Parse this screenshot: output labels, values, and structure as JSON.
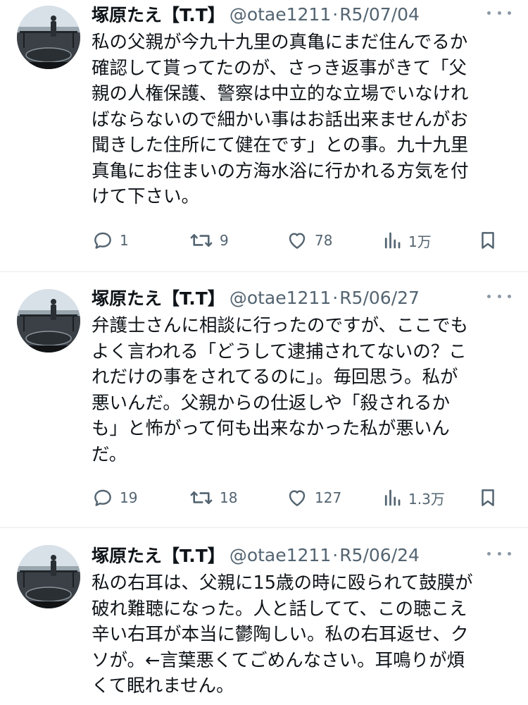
{
  "tweets": [
    {
      "name": "塚原たえ【T.T】",
      "handle": "@otae1211",
      "separator": "·",
      "date": "R5/07/04",
      "lines": [
        "私の父親が今九十九里の真亀にまだ住んでるか",
        "確認して貰ってたのが、さっき返事がきて「父",
        "親の人権保護、警察は中立的な立場でいなけれ",
        "ばならないので細かい事はお話出来ませんがお",
        "聞きした住所にて健在です」との事。九十九里",
        "真亀にお住まいの方海水浴に行かれる方気を付",
        "けて下さい。"
      ],
      "replies": "1",
      "retweets": "9",
      "likes": "78",
      "views": "1万"
    },
    {
      "name": "塚原たえ【T.T】",
      "handle": "@otae1211",
      "separator": "·",
      "date": "R5/06/27",
      "lines": [
        "弁護士さんに相談に行ったのですが、ここでも",
        "よく言われる「どうして逮捕されてないの？こ",
        "れだけの事をされてるのに」。毎回思う。私が",
        "悪いんだ。父親からの仕返しや「殺されるか",
        "も」と怖がって何も出来なかった私が悪いん",
        "だ。"
      ],
      "replies": "19",
      "retweets": "18",
      "likes": "127",
      "views": "1.3万"
    },
    {
      "name": "塚原たえ【T.T】",
      "handle": "@otae1211",
      "separator": "·",
      "date": "R5/06/24",
      "lines": [
        "私の右耳は、父親に15歳の時に殴られて鼓膜が",
        "破れ難聴になった。人と話してて、この聴こえ",
        "辛い右耳が本当に鬱陶しい。私の右耳返せ、ク",
        "ソが。←言葉悪くてごめんなさい。耳鳴りが煩",
        "くて眠れません。"
      ]
    }
  ]
}
